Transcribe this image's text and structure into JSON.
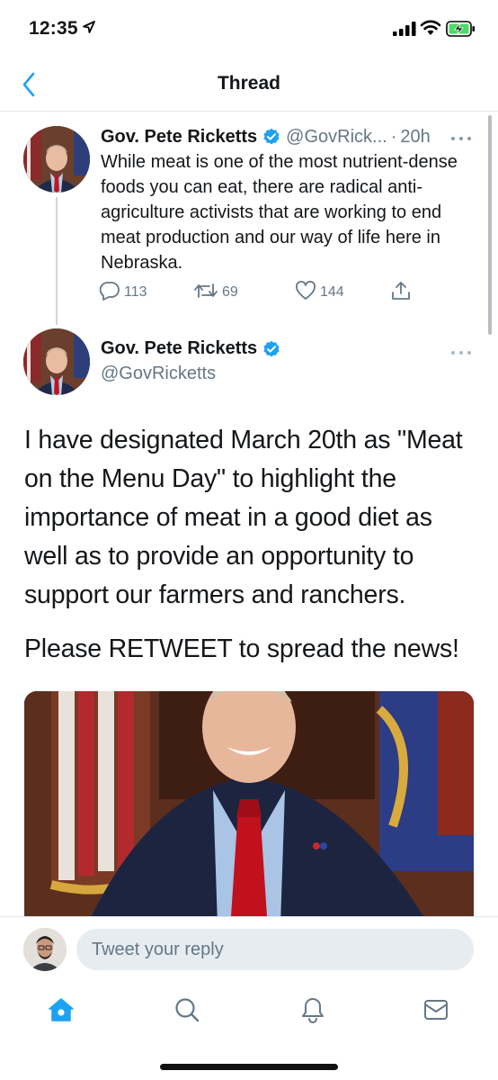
{
  "status_bar": {
    "time": "12:35",
    "icons": [
      "location-arrow-icon",
      "cellular-signal-icon",
      "wifi-icon",
      "battery-charging-icon"
    ]
  },
  "nav": {
    "title": "Thread",
    "back_icon": "chevron-left-icon"
  },
  "colors": {
    "accent": "#1da1f2",
    "text_primary": "#14171a",
    "text_secondary": "#657786",
    "divider": "#e1e8ed",
    "input_bg": "#e6ecf0"
  },
  "thread_parent": {
    "author_name": "Gov. Pete Ricketts",
    "handle": "@GovRick...",
    "separator": "·",
    "time": "20h",
    "text": "While meat is one of the most nutrient-dense foods you can eat, there are radical anti-agriculture activists that are working to end meat production and our way of life here in Nebraska.",
    "actions": {
      "replies": "113",
      "retweets": "69",
      "likes": "144"
    }
  },
  "focused_tweet": {
    "author_name": "Gov. Pete Ricketts",
    "handle": "@GovRicketts",
    "text": "I have designated March 20th as \"Meat on the Menu Day\" to highlight the importance of meat in a good diet as well as to provide an opportunity to support our farmers and ranchers.",
    "text2": "Please RETWEET to spread the news!"
  },
  "reply_bar": {
    "placeholder": "Tweet your reply"
  },
  "tab_bar": {
    "tabs": [
      "home-icon",
      "search-icon",
      "bell-icon",
      "mail-icon"
    ],
    "active": "home-icon"
  }
}
